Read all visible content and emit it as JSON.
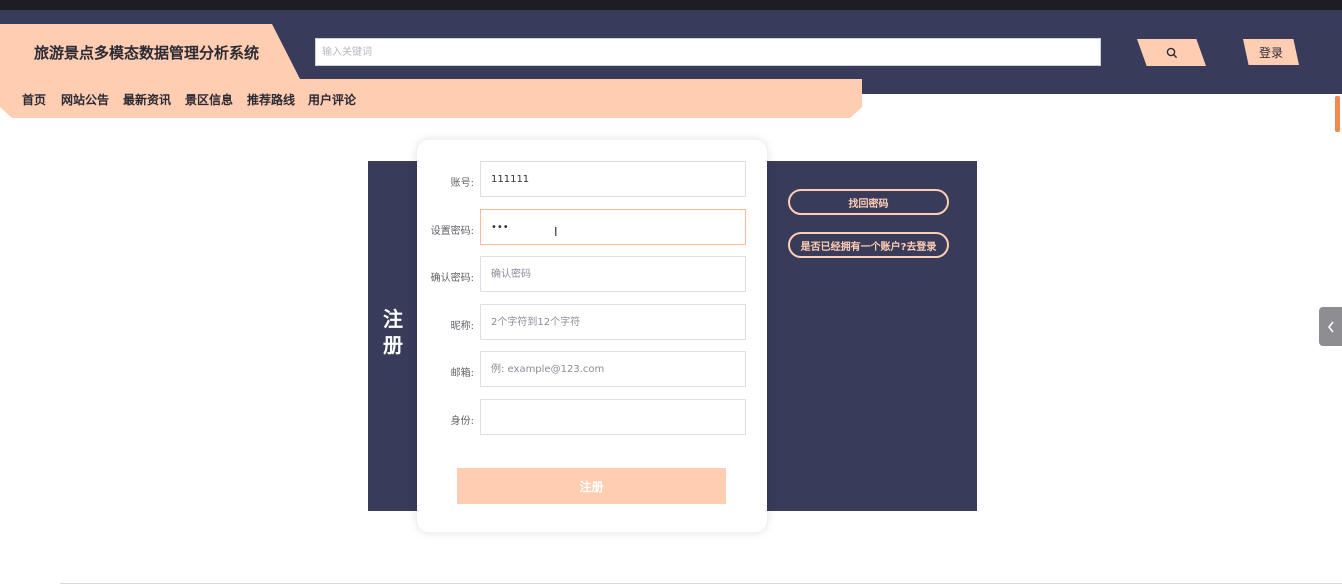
{
  "header": {
    "site_title": "旅游景点多模态数据管理分析系统",
    "search_placeholder": "输入关键词",
    "search_icon": "search-icon",
    "login_label": "登录"
  },
  "nav": {
    "items": [
      {
        "label": "首页"
      },
      {
        "label": "网站公告"
      },
      {
        "label": "最新资讯"
      },
      {
        "label": "景区信息"
      },
      {
        "label": "推荐路线"
      },
      {
        "label": "用户评论"
      }
    ]
  },
  "register": {
    "panel_title": "注册",
    "fields": [
      {
        "label": "账号:",
        "value": "111111",
        "placeholder": ""
      },
      {
        "label": "设置密码:",
        "value": "•••",
        "placeholder": ""
      },
      {
        "label": "确认密码:",
        "value": "",
        "placeholder": "确认密码"
      },
      {
        "label": "昵称:",
        "value": "",
        "placeholder": "2个字符到12个字符"
      },
      {
        "label": "邮箱:",
        "value": "",
        "placeholder": "例: example@123.com"
      },
      {
        "label": "身份:",
        "value": "",
        "placeholder": ""
      }
    ],
    "submit_label": "注册",
    "forgot_label": "找回密码",
    "have_account_label": "是否已经拥有一个账户?去登录"
  },
  "colors": {
    "navy": "#383c5a",
    "peach": "#ffcdb2",
    "accent": "#f08a52"
  }
}
